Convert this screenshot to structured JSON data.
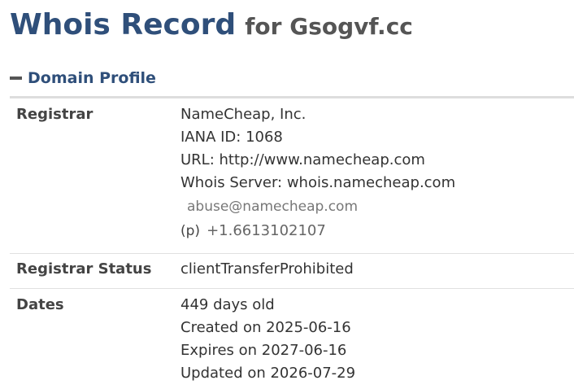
{
  "header": {
    "title_main": "Whois Record",
    "title_sub": "for Gsogvf.cc"
  },
  "section": {
    "title": "Domain Profile",
    "icon": "minus-icon"
  },
  "rows": {
    "registrar": {
      "label": "Registrar",
      "name": "NameCheap, Inc.",
      "iana": "IANA ID: 1068",
      "url": "URL: http://www.namecheap.com",
      "whois_server": "Whois Server: whois.namecheap.com",
      "abuse_email": "abuse@namecheap.com",
      "phone_prefix": "(p)",
      "phone": "+1.6613102107"
    },
    "status": {
      "label": "Registrar Status",
      "value": "clientTransferProhibited"
    },
    "dates": {
      "label": "Dates",
      "age": "449 days old",
      "created": "Created on 2025-06-16",
      "expires": "Expires on 2027-06-16",
      "updated": "Updated on 2026-07-29"
    }
  },
  "colors": {
    "title_blue": "#2f4f7a",
    "text_gray": "#333333",
    "rule_gray": "#dddddd"
  }
}
